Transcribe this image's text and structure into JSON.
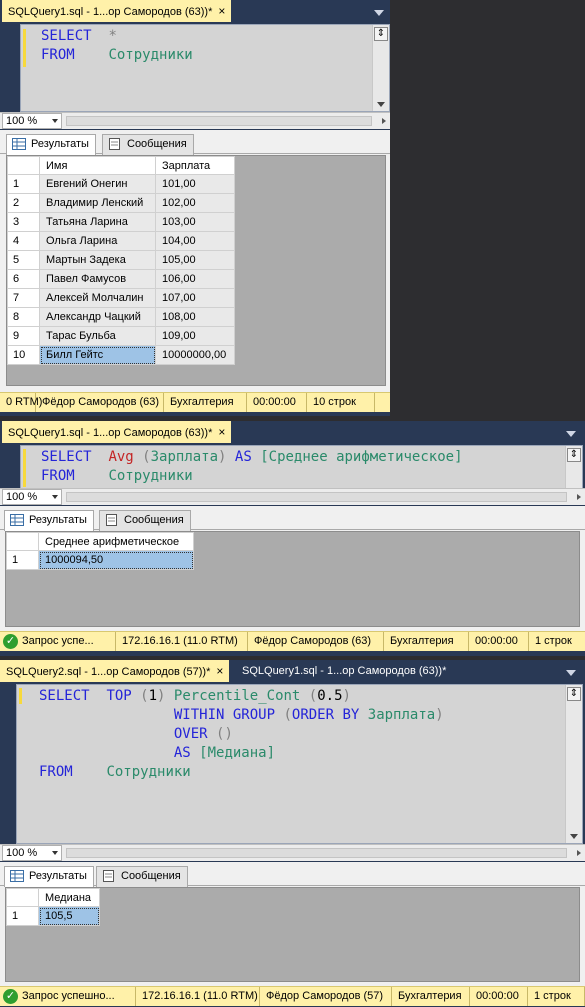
{
  "colors": {
    "tab_active": "#fff1a9",
    "status_bar": "#fff1a9",
    "keyword": "#2424d8",
    "function": "#c42424",
    "object": "#2a8a6a",
    "selection": "#9ec3e6"
  },
  "w1": {
    "tab_label": "SQLQuery1.sql - 1...ор Самородов (63))*",
    "tab_close": "×",
    "code": [
      [
        {
          "t": "SELECT",
          "c": "kw"
        },
        {
          "t": "  ",
          "c": ""
        },
        {
          "t": "*",
          "c": "gray"
        }
      ],
      [
        {
          "t": "FROM",
          "c": "kw"
        },
        {
          "t": "    ",
          "c": ""
        },
        {
          "t": "Сотрудники",
          "c": "obj"
        }
      ]
    ],
    "zoom": "100 %",
    "tab_results": "Результаты",
    "tab_messages": "Сообщения",
    "columns": [
      "",
      "Имя",
      "Зарплата"
    ],
    "rows": [
      [
        "1",
        "Евгений Онегин",
        "101,00"
      ],
      [
        "2",
        "Владимир Ленский",
        "102,00"
      ],
      [
        "3",
        "Татьяна Ларина",
        "103,00"
      ],
      [
        "4",
        "Ольга Ларина",
        "104,00"
      ],
      [
        "5",
        "Мартын Задека",
        "105,00"
      ],
      [
        "6",
        "Павел Фамусов",
        "106,00"
      ],
      [
        "7",
        "Алексей Молчалин",
        "107,00"
      ],
      [
        "8",
        "Александр Чацкий",
        "108,00"
      ],
      [
        "9",
        "Тарас Бульба",
        "109,00"
      ],
      [
        "10",
        "Билл Гейтс",
        "10000000,00"
      ]
    ],
    "status": [
      "0 RTM)",
      "Фёдор Самородов (63)",
      "Бухгалтерия",
      "00:00:00",
      "10 строк"
    ]
  },
  "w2": {
    "tab_label": "SQLQuery1.sql - 1...ор Самородов (63))*",
    "tab_close": "×",
    "code": [
      [
        {
          "t": "SELECT",
          "c": "kw"
        },
        {
          "t": "  ",
          "c": ""
        },
        {
          "t": "Avg",
          "c": "fn"
        },
        {
          "t": " ",
          "c": ""
        },
        {
          "t": "(",
          "c": "gray"
        },
        {
          "t": "Зарплата",
          "c": "obj"
        },
        {
          "t": ")",
          "c": "gray"
        },
        {
          "t": " ",
          "c": ""
        },
        {
          "t": "AS",
          "c": "kw"
        },
        {
          "t": " ",
          "c": ""
        },
        {
          "t": "[Среднее арифметическое]",
          "c": "obj"
        }
      ],
      [
        {
          "t": "FROM",
          "c": "kw"
        },
        {
          "t": "    ",
          "c": ""
        },
        {
          "t": "Сотрудники",
          "c": "obj"
        }
      ]
    ],
    "zoom": "100 %",
    "tab_results": "Результаты",
    "tab_messages": "Сообщения",
    "columns": [
      "",
      "Среднее арифметическое"
    ],
    "rows": [
      [
        "1",
        "1000094,50"
      ]
    ],
    "status": [
      "Запрос успе...",
      "172.16.16.1 (11.0 RTM)",
      "Фёдор Самородов (63)",
      "Бухгалтерия",
      "00:00:00",
      "1 строк"
    ]
  },
  "w3": {
    "tab_label": "SQLQuery2.sql - 1...ор Самородов (57))*",
    "tab_close": "×",
    "tab2_label": "SQLQuery1.sql - 1...ор Самородов (63))*",
    "code": [
      [
        {
          "t": "SELECT",
          "c": "kw"
        },
        {
          "t": "  ",
          "c": ""
        },
        {
          "t": "TOP",
          "c": "kw"
        },
        {
          "t": " ",
          "c": ""
        },
        {
          "t": "(",
          "c": "gray"
        },
        {
          "t": "1",
          "c": ""
        },
        {
          "t": ")",
          "c": "gray"
        },
        {
          "t": " ",
          "c": ""
        },
        {
          "t": "Percentile_Cont",
          "c": "obj"
        },
        {
          "t": " ",
          "c": ""
        },
        {
          "t": "(",
          "c": "gray"
        },
        {
          "t": "0.5",
          "c": ""
        },
        {
          "t": ")",
          "c": "gray"
        }
      ],
      [
        {
          "t": "                ",
          "c": ""
        },
        {
          "t": "WITHIN GROUP",
          "c": "kw"
        },
        {
          "t": " ",
          "c": ""
        },
        {
          "t": "(",
          "c": "gray"
        },
        {
          "t": "ORDER BY",
          "c": "kw"
        },
        {
          "t": " ",
          "c": ""
        },
        {
          "t": "Зарплата",
          "c": "obj"
        },
        {
          "t": ")",
          "c": "gray"
        }
      ],
      [
        {
          "t": "                ",
          "c": ""
        },
        {
          "t": "OVER",
          "c": "kw"
        },
        {
          "t": " ",
          "c": ""
        },
        {
          "t": "()",
          "c": "gray"
        }
      ],
      [
        {
          "t": "                ",
          "c": ""
        },
        {
          "t": "AS",
          "c": "kw"
        },
        {
          "t": " ",
          "c": ""
        },
        {
          "t": "[Медиана]",
          "c": "obj"
        }
      ],
      [
        {
          "t": "FROM",
          "c": "kw"
        },
        {
          "t": "    ",
          "c": ""
        },
        {
          "t": "Сотрудники",
          "c": "obj"
        }
      ]
    ],
    "zoom": "100 %",
    "tab_results": "Результаты",
    "tab_messages": "Сообщения",
    "columns": [
      "",
      "Медиана"
    ],
    "rows": [
      [
        "1",
        "105,5"
      ]
    ],
    "status": [
      "Запрос успешно...",
      "172.16.16.1 (11.0 RTM)",
      "Фёдор Самородов (57)",
      "Бухгалтерия",
      "00:00:00",
      "1 строк"
    ]
  }
}
